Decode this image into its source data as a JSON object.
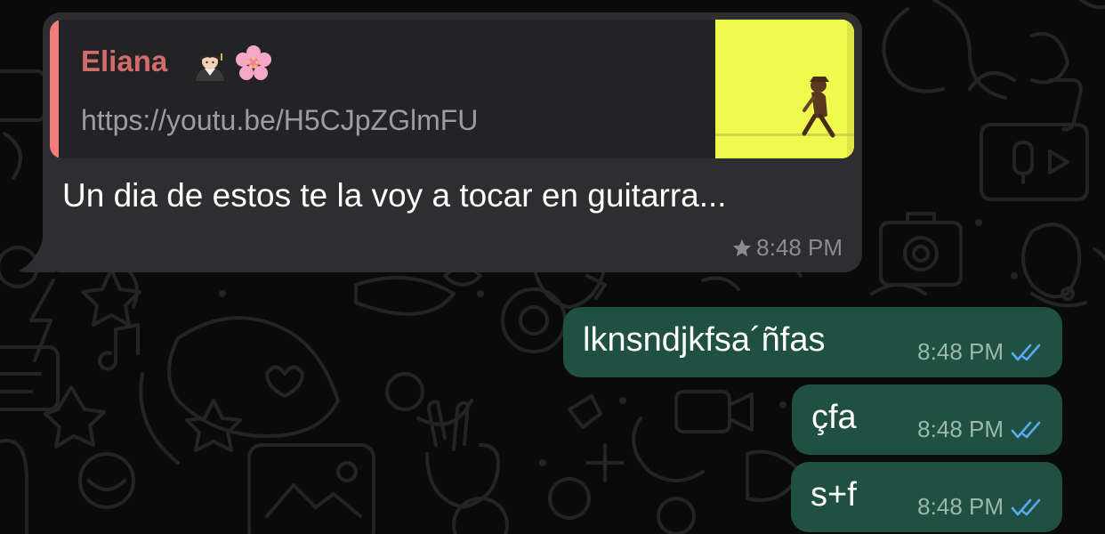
{
  "colors": {
    "background": "#0a0a0a",
    "incoming_bubble": "#2e2e31",
    "outgoing_bubble": "#1f5041",
    "quote_bar": "#f07c7c",
    "quote_author": "#d26b6b",
    "read_receipt": "#5aa9f5"
  },
  "incoming": {
    "quote": {
      "author": "Eliana",
      "author_emojis": [
        "student-emoji-icon",
        "cherry-blossom-emoji-icon"
      ],
      "link": "https://youtu.be/H5CJpZGlmFU",
      "thumbnail": "video-thumbnail-yellow-figure"
    },
    "text": "Un dia de estos te la voy a tocar en guitarra...",
    "starred": true,
    "time": "8:48 PM"
  },
  "outgoing": [
    {
      "text": "lknsndjkfsa´ñfas",
      "time": "8:48 PM",
      "status": "read-double-check-icon"
    },
    {
      "text": "çfa",
      "time": "8:48 PM",
      "status": "read-double-check-icon"
    },
    {
      "text": "s+f",
      "time": "8:48 PM",
      "status": "read-double-check-icon"
    }
  ]
}
